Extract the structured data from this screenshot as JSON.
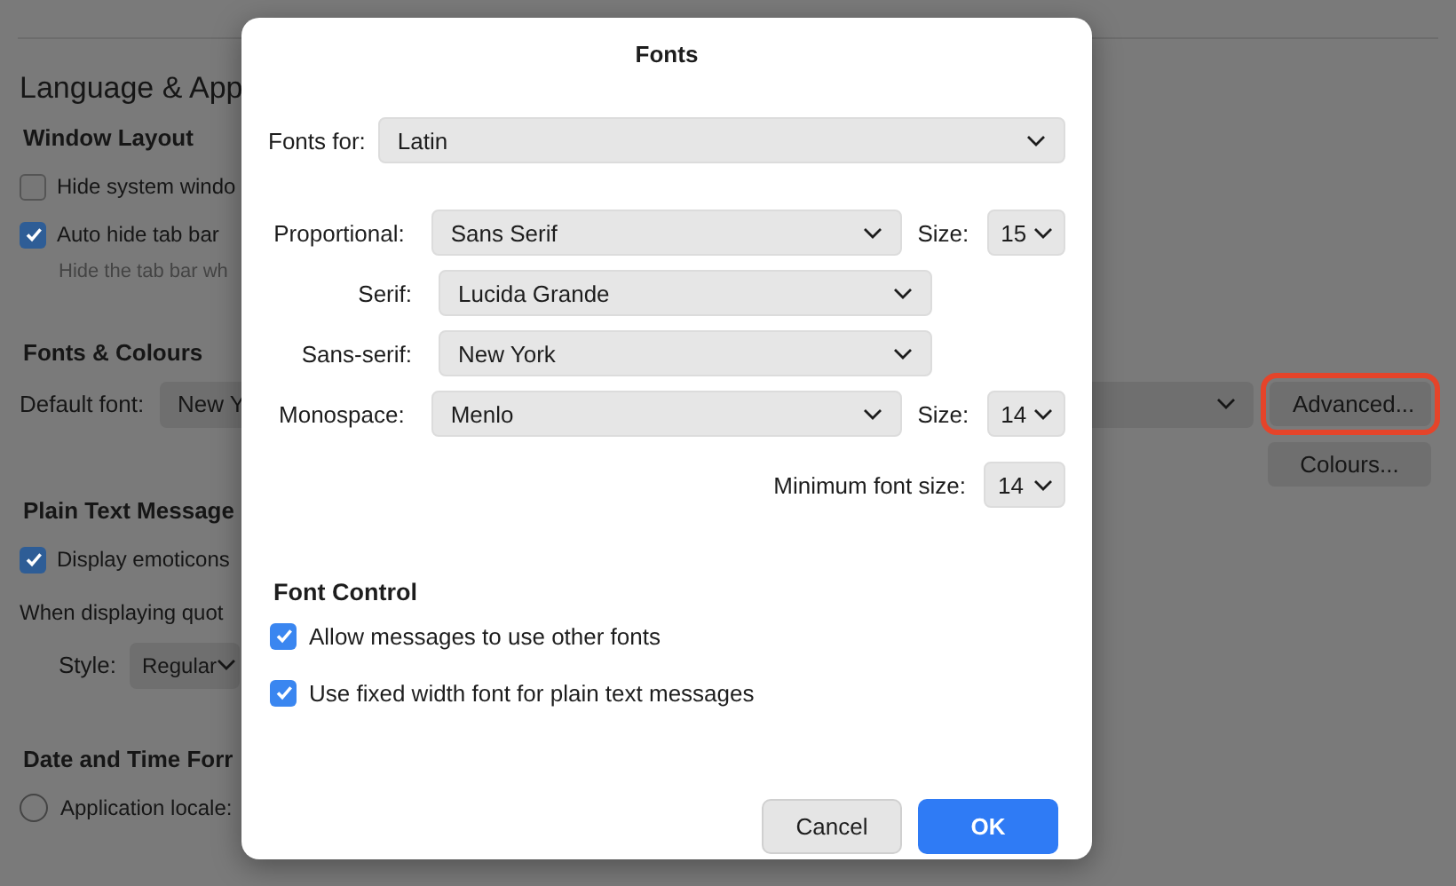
{
  "background": {
    "title": "Language & App",
    "items": [
      {
        "kind": "heading",
        "text": "Window Layout"
      },
      {
        "kind": "checkbox",
        "label": "Hide system windo",
        "checked": false
      },
      {
        "kind": "checkbox",
        "label": "Auto hide tab bar",
        "checked": true
      },
      {
        "kind": "hint",
        "text": "Hide the tab bar wh"
      },
      {
        "kind": "heading",
        "text": "Fonts & Colours"
      },
      {
        "kind": "select",
        "label": "Default font:",
        "value": "New Y",
        "button": {
          "label": "Advanced...",
          "highlighted": true
        }
      },
      {
        "kind": "button",
        "label": "Colours..."
      },
      {
        "kind": "heading",
        "text": "Plain Text Message"
      },
      {
        "kind": "checkbox",
        "label": "Display emoticons",
        "checked": true
      },
      {
        "kind": "text",
        "text": "When displaying quot"
      },
      {
        "kind": "style",
        "label": "Style:",
        "value": "Regular"
      },
      {
        "kind": "heading",
        "text": "Date and Time Forr"
      },
      {
        "kind": "radio",
        "label": "Application locale:",
        "selected": false
      }
    ]
  },
  "dialog": {
    "title": "Fonts",
    "fonts_for": {
      "label": "Fonts for:",
      "value": "Latin"
    },
    "rows": [
      {
        "label": "Proportional:",
        "value": "Sans Serif",
        "size": {
          "label": "Size:",
          "value": "15"
        }
      },
      {
        "label": "Serif:",
        "value": "Lucida Grande"
      },
      {
        "label": "Sans-serif:",
        "value": "New York"
      },
      {
        "label": "Monospace:",
        "value": "Menlo",
        "size": {
          "label": "Size:",
          "value": "14"
        }
      }
    ],
    "minimum": {
      "label": "Minimum font size:",
      "value": "14"
    },
    "control_title": "Font Control",
    "checks": [
      {
        "label": "Allow messages to use other fonts",
        "checked": true
      },
      {
        "label": "Use fixed width font for plain text messages",
        "checked": true
      }
    ],
    "buttons": [
      {
        "label": "Cancel",
        "kind": "secondary"
      },
      {
        "label": "OK",
        "kind": "primary"
      }
    ]
  }
}
